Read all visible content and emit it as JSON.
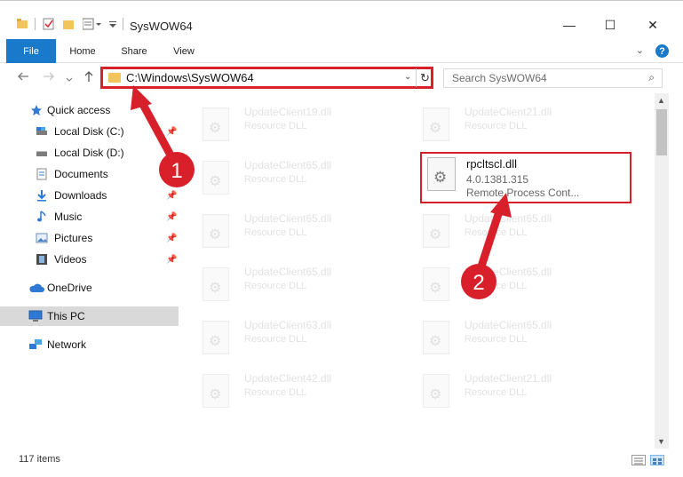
{
  "window": {
    "title": "SysWOW64",
    "minimize": "—",
    "maximize": "☐",
    "close": "✕"
  },
  "ribbon": {
    "tabs": [
      "File",
      "Home",
      "Share",
      "View"
    ],
    "collapse": "⌄",
    "help": "?"
  },
  "address": {
    "path": "C:\\Windows\\SysWOW64",
    "dropdown": "⌄",
    "refresh": "↻"
  },
  "search": {
    "placeholder": "Search SysWOW64",
    "icon": "⌕"
  },
  "sidebar": {
    "items": [
      {
        "label": "Quick access",
        "icon": "star-icon"
      },
      {
        "label": "Local Disk (C:)",
        "icon": "drive-icon",
        "pinned": true
      },
      {
        "label": "Local Disk (D:)",
        "icon": "drive-icon"
      },
      {
        "label": "Documents",
        "icon": "documents-icon",
        "pinned": true
      },
      {
        "label": "Downloads",
        "icon": "downloads-icon",
        "pinned": true
      },
      {
        "label": "Music",
        "icon": "music-icon",
        "pinned": true
      },
      {
        "label": "Pictures",
        "icon": "pictures-icon",
        "pinned": true
      },
      {
        "label": "Videos",
        "icon": "videos-icon",
        "pinned": true
      },
      {
        "label": "OneDrive",
        "icon": "cloud-icon"
      },
      {
        "label": "This PC",
        "icon": "computer-icon",
        "selected": true
      },
      {
        "label": "Network",
        "icon": "network-icon"
      }
    ]
  },
  "files": {
    "left": [
      {
        "name": "UpdateClient19.dll",
        "type": "Resource DLL"
      },
      {
        "name": "UpdateClient65.dll",
        "type": "Resource DLL"
      },
      {
        "name": "UpdateClient65.dll",
        "type": "Resource DLL"
      },
      {
        "name": "UpdateClient65.dll",
        "type": "Resource DLL"
      },
      {
        "name": "UpdateClient63.dll",
        "type": "Resource DLL"
      },
      {
        "name": "UpdateClient42.dll",
        "type": "Resource DLL"
      }
    ],
    "right": [
      {
        "name": "UpdateClient21.dll",
        "type": "Resource DLL"
      },
      {
        "name": "UpdateClient65.dll",
        "type": "Resource DLL"
      },
      {
        "name": "UpdateClient65.dll",
        "type": "Resource DLL"
      },
      {
        "name": "UpdateClient65.dll",
        "type": "Resource DLL"
      },
      {
        "name": "UpdateClient21.dll",
        "type": "Resource DLL"
      }
    ],
    "highlighted": {
      "name": "rpcltscl.dll",
      "version": "4.0.1381.315",
      "description": "Remote Process Cont..."
    }
  },
  "status": {
    "count": "117 items"
  },
  "annotations": {
    "step1": "1",
    "step2": "2",
    "color": "#d8202a"
  }
}
